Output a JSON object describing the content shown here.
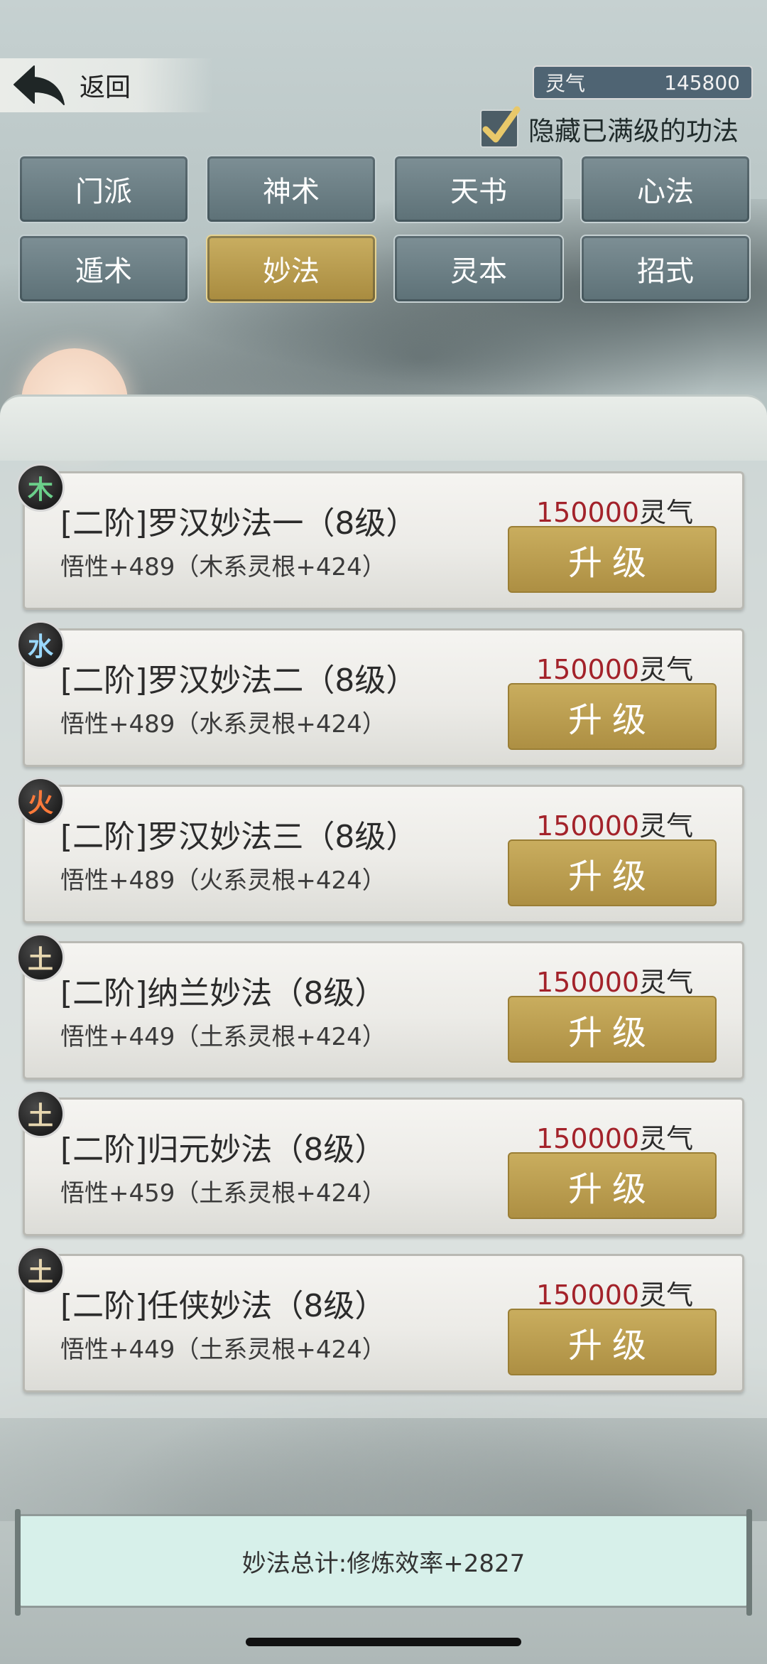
{
  "header": {
    "back_label": "返回",
    "currency_label": "灵气",
    "currency_value": "145800",
    "hide_maxed_label": "隐藏已满级的功法",
    "hide_maxed_checked": true
  },
  "tabs": [
    {
      "label": "门派",
      "active": false
    },
    {
      "label": "神术",
      "active": false
    },
    {
      "label": "天书",
      "active": false
    },
    {
      "label": "心法",
      "active": false
    },
    {
      "label": "遁术",
      "active": false
    },
    {
      "label": "妙法",
      "active": true
    },
    {
      "label": "灵本",
      "active": false
    },
    {
      "label": "招式",
      "active": false
    }
  ],
  "items": [
    {
      "element": "木",
      "element_color": "#6bd08a",
      "title": "[二阶]罗汉妙法一（8级）",
      "desc": "悟性+489（木系灵根+424）",
      "cost_value": "150000",
      "cost_unit": "灵气",
      "button_label": "升级"
    },
    {
      "element": "水",
      "element_color": "#9ad9ff",
      "title": "[二阶]罗汉妙法二（8级）",
      "desc": "悟性+489（水系灵根+424）",
      "cost_value": "150000",
      "cost_unit": "灵气",
      "button_label": "升级"
    },
    {
      "element": "火",
      "element_color": "#ff7a3a",
      "title": "[二阶]罗汉妙法三（8级）",
      "desc": "悟性+489（火系灵根+424）",
      "cost_value": "150000",
      "cost_unit": "灵气",
      "button_label": "升级"
    },
    {
      "element": "土",
      "element_color": "#e7d7b0",
      "title": "[二阶]纳兰妙法（8级）",
      "desc": "悟性+449（土系灵根+424）",
      "cost_value": "150000",
      "cost_unit": "灵气",
      "button_label": "升级"
    },
    {
      "element": "土",
      "element_color": "#e7d7b0",
      "title": "[二阶]归元妙法（8级）",
      "desc": "悟性+459（土系灵根+424）",
      "cost_value": "150000",
      "cost_unit": "灵气",
      "button_label": "升级"
    },
    {
      "element": "土",
      "element_color": "#e7d7b0",
      "title": "[二阶]任侠妙法（8级）",
      "desc": "悟性+449（土系灵根+424）",
      "cost_value": "150000",
      "cost_unit": "灵气",
      "button_label": "升级"
    }
  ],
  "summary": "妙法总计:修炼效率+2827"
}
